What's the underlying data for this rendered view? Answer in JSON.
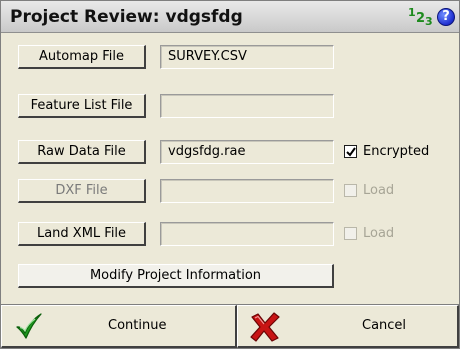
{
  "window": {
    "title": "Project Review: vdgsfdg",
    "input_mode": {
      "d1": "1",
      "d2": "2",
      "d3": "3"
    },
    "help_symbol": "?"
  },
  "files": [
    {
      "button_label": "Automap File",
      "value": "SURVEY.CSV",
      "enabled": true
    },
    {
      "button_label": "Feature List File",
      "value": "",
      "enabled": true
    },
    {
      "button_label": "Raw Data File",
      "value": "vdgsfdg.rae",
      "enabled": true,
      "checkbox": {
        "label": "Encrypted",
        "checked": true,
        "enabled": true
      }
    },
    {
      "button_label": "DXF File",
      "value": "",
      "enabled": false,
      "checkbox": {
        "label": "Load",
        "checked": false,
        "enabled": false
      }
    },
    {
      "button_label": "Land XML File",
      "value": "",
      "enabled": false,
      "checkbox": {
        "label": "Load",
        "checked": false,
        "enabled": false
      }
    }
  ],
  "modify_button_label": "Modify Project Information",
  "footer": {
    "continue_label": "Continue",
    "cancel_label": "Cancel"
  },
  "colors": {
    "continue_check": "#1f9a1f",
    "cancel_x": "#c81414",
    "help_icon": "#1f2fd0",
    "input_mode": "#1d8a1d"
  },
  "icons": {
    "continue": "checkmark-icon",
    "cancel": "red-x-icon",
    "help": "help-icon",
    "input_mode": "numeric-input-mode-icon"
  }
}
